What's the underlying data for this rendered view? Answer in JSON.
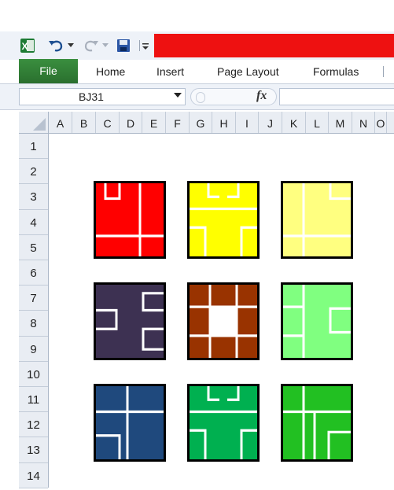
{
  "quick_access": {
    "excel_icon": "excel-logo-icon",
    "undo_icon": "undo-icon",
    "redo_icon": "redo-icon",
    "save_icon": "save-icon",
    "customize_icon": "customize-qat-icon",
    "title_bar_color": "#ee1111"
  },
  "ribbon": {
    "tabs": [
      "File",
      "Home",
      "Insert",
      "Page Layout",
      "Formulas"
    ],
    "file_tab_color": "#2e7d32"
  },
  "formula_bar": {
    "name_box": "BJ31",
    "fx_label": "fx",
    "formula": ""
  },
  "columns": [
    "A",
    "B",
    "C",
    "D",
    "E",
    "F",
    "G",
    "H",
    "I",
    "J",
    "K",
    "L",
    "M",
    "N",
    "O"
  ],
  "rows": [
    "1",
    "2",
    "3",
    "4",
    "5",
    "6",
    "7",
    "8",
    "9",
    "10",
    "11",
    "12",
    "13",
    "14"
  ],
  "tiles": [
    {
      "color": "#ff0000",
      "pattern": "tl"
    },
    {
      "color": "#ffff00",
      "pattern": "tb"
    },
    {
      "color": "#ffff80",
      "pattern": "tr"
    },
    {
      "color": "#3d3152",
      "pattern": "rl"
    },
    {
      "color": "#993300",
      "pattern": "ring"
    },
    {
      "color": "#80ff80",
      "pattern": "r"
    },
    {
      "color": "#1f497d",
      "pattern": "tlbl"
    },
    {
      "color": "#00b050",
      "pattern": "tb"
    },
    {
      "color": "#22c022",
      "pattern": "tlbr"
    }
  ]
}
